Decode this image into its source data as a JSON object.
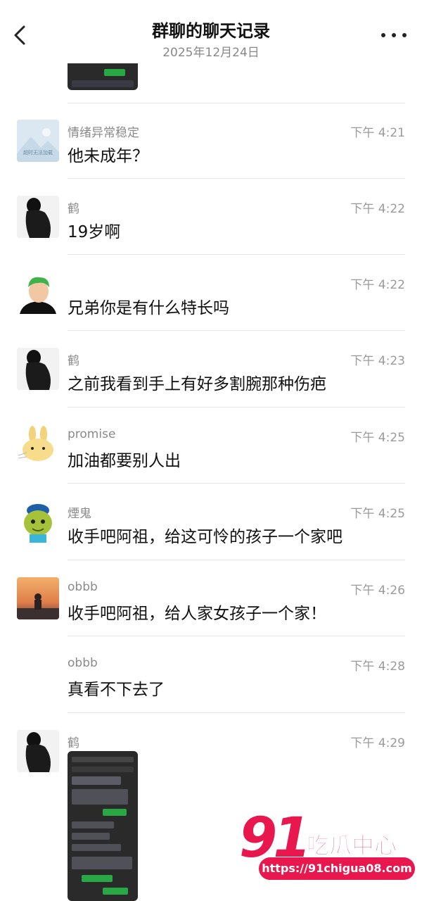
{
  "header": {
    "title": "群聊的聊天记录",
    "date": "2025年12月24日"
  },
  "messages": [
    {
      "sender": "情绪异常稳定",
      "time": "下午 4:21",
      "text": "他未成年？",
      "avatar": "landscape-placeholder-avatar",
      "avatar_caption": "超时无法加载"
    },
    {
      "sender": "鹤",
      "time": "下午 4:22",
      "text": "19岁啊",
      "avatar": "dark-figure-avatar"
    },
    {
      "sender": "",
      "time": "下午 4:22",
      "text": "兄弟你是有什么特长吗",
      "avatar": "green-hair-anime-avatar"
    },
    {
      "sender": "鹤",
      "time": "下午 4:23",
      "text": "之前我看到手上有好多割腕那种伤疤",
      "avatar": "dark-figure-avatar"
    },
    {
      "sender": "promise",
      "time": "下午 4:25",
      "text": "加油都要别人出",
      "avatar": "cartoon-rabbit-avatar"
    },
    {
      "sender": "煙鬼",
      "time": "下午 4:25",
      "text": "收手吧阿祖，给这可怜的孩子一个家吧",
      "avatar": "shrek-cartoon-avatar"
    },
    {
      "sender": "obbb",
      "time": "下午 4:26",
      "text": "收手吧阿祖，给人家女孩子一个家！",
      "avatar": "sunset-person-avatar"
    },
    {
      "sender": "obbb",
      "time": "下午 4:28",
      "text": "真看不下去了",
      "avatar": ""
    },
    {
      "sender": "鹤",
      "time": "下午 4:29",
      "text": "",
      "avatar": "dark-figure-avatar",
      "attachment": "chat-screenshot-image"
    }
  ],
  "watermark": {
    "number": "91",
    "name": "吃瓜中心",
    "url": "https://91chigua08.com"
  },
  "colors": {
    "accent": "#e8174e",
    "meta_text": "#9a9a9a",
    "divider": "#e6e6e6"
  }
}
